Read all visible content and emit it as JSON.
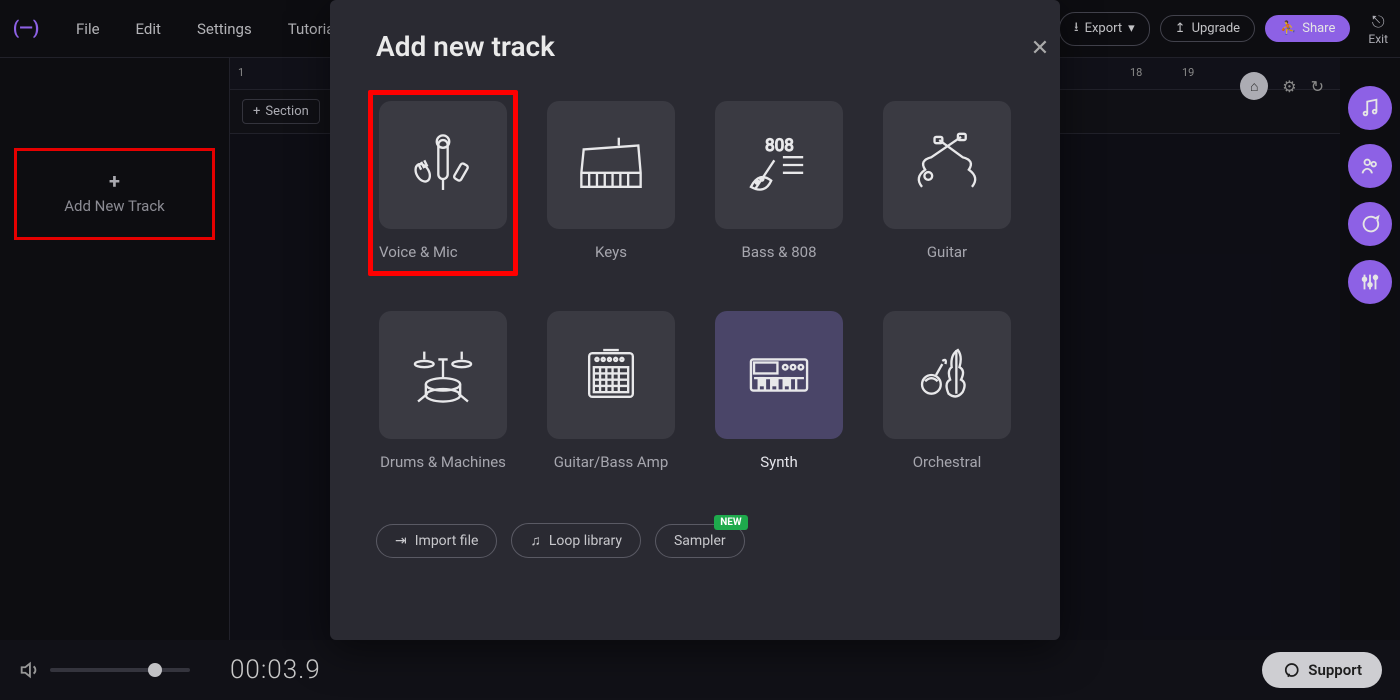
{
  "menu": {
    "file": "File",
    "edit": "Edit",
    "settings": "Settings",
    "tutorials": "Tutorials"
  },
  "toolbar": {
    "export": "Export",
    "upgrade": "Upgrade",
    "share": "Share",
    "exit": "Exit"
  },
  "sidebar": {
    "add_track": "Add New Track"
  },
  "section_btn": "Section",
  "ruler_ticks": [
    "1",
    "18",
    "19"
  ],
  "transport": {
    "time": "00:03.9",
    "support": "Support"
  },
  "zoom": {
    "in": "+",
    "out": "−"
  },
  "modal": {
    "title": "Add new track",
    "options": [
      {
        "label": "Voice & Mic"
      },
      {
        "label": "Keys"
      },
      {
        "label": "Bass & 808"
      },
      {
        "label": "Guitar"
      },
      {
        "label": "Drums & Machines"
      },
      {
        "label": "Guitar/Bass Amp"
      },
      {
        "label": "Synth"
      },
      {
        "label": "Orchestral"
      }
    ],
    "footer": {
      "import": "Import file",
      "loop_library": "Loop library",
      "sampler": "Sampler",
      "sampler_badge": "NEW"
    }
  }
}
